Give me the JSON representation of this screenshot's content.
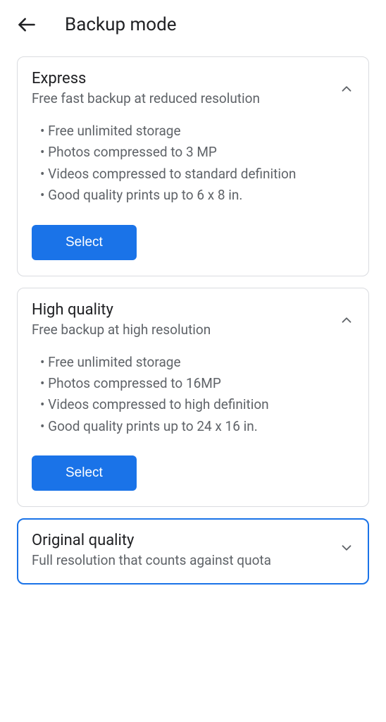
{
  "header": {
    "title": "Backup mode"
  },
  "cards": [
    {
      "title": "Express",
      "subtitle": "Free fast backup at reduced resolution",
      "bullets": [
        "Free unlimited storage",
        "Photos compressed to 3 MP",
        "Videos compressed to standard definition",
        "Good quality prints up to 6 x 8 in."
      ],
      "button": "Select",
      "expanded": true
    },
    {
      "title": "High quality",
      "subtitle": "Free backup at high resolution",
      "bullets": [
        "Free unlimited storage",
        "Photos compressed to 16MP",
        "Videos compressed to high definition",
        "Good quality prints up to 24 x 16 in."
      ],
      "button": "Select",
      "expanded": true
    },
    {
      "title": "Original quality",
      "subtitle": "Full resolution that counts against quota",
      "expanded": false
    }
  ]
}
